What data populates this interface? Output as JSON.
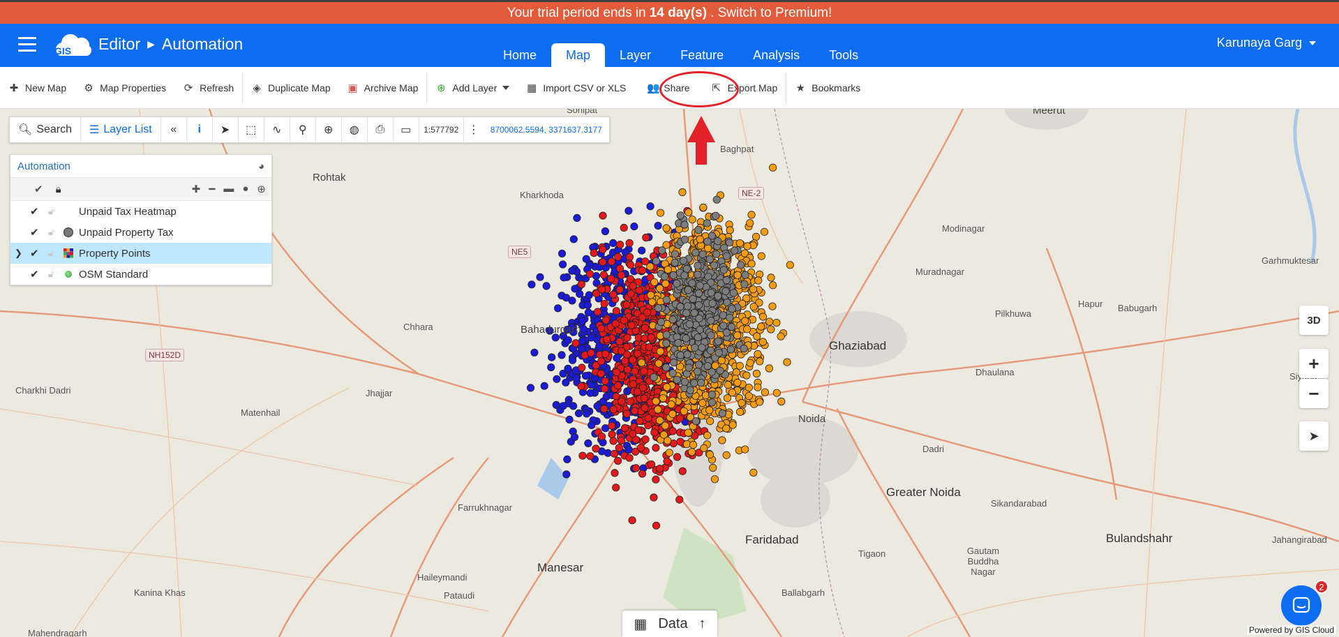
{
  "banner": {
    "prefix": "Your trial period ends in",
    "days": "14 day(s)",
    "suffix": ". Switch to Premium!"
  },
  "header": {
    "logo_text": "GIS",
    "breadcrumb": [
      "Editor",
      "Automation"
    ],
    "tabs": [
      "Home",
      "Map",
      "Layer",
      "Feature",
      "Analysis",
      "Tools"
    ],
    "active_tab": "Map",
    "user": "Karunaya Garg"
  },
  "toolbar": {
    "new_map": "New Map",
    "map_properties": "Map Properties",
    "refresh": "Refresh",
    "duplicate_map": "Duplicate Map",
    "archive_map": "Archive Map",
    "add_layer": "Add Layer",
    "import_csv": "Import CSV or XLS",
    "share": "Share",
    "export_map": "Export Map",
    "bookmarks": "Bookmarks"
  },
  "map_tools": {
    "search": "Search",
    "layer_list": "Layer List",
    "scale": "1:577792",
    "coords": "8700062.5594, 3371637.3177"
  },
  "layer_panel": {
    "map_name": "Automation",
    "layers": [
      {
        "name": "Unpaid Tax Heatmap",
        "symbol": "none"
      },
      {
        "name": "Unpaid Property Tax",
        "symbol": "grey-circle"
      },
      {
        "name": "Property Points",
        "symbol": "grid",
        "selected": true
      },
      {
        "name": "OSM Standard",
        "symbol": "green-dot"
      }
    ]
  },
  "map_labels": {
    "cities_big": [
      "Ghaziabad",
      "Greater Noida",
      "Faridabad",
      "Manesar",
      "Bulandshahr"
    ],
    "towns": [
      "Sonipat",
      "Meerut",
      "Rohtak",
      "Baghpat",
      "Kharkhoda",
      "Modinagar",
      "Muradnagar",
      "Hapur",
      "Babugarh",
      "Garhmuktesar",
      "Pilkhuwa",
      "Chhara",
      "Bahadurgarh",
      "Charkhi Dadri",
      "Jhajjar",
      "Matenhail",
      "Dhaulana",
      "Siyana",
      "Dadri",
      "Sikandarabad",
      "Farrukhnagar",
      "Haileymandi",
      "Pataudi",
      "Kanina Khas",
      "Ballabgarh",
      "Tigaon",
      "Jahangirabad",
      "Gautam Buddha Nagar",
      "Noida",
      "Mahendragarh"
    ],
    "roads": [
      "NE-2",
      "NE5",
      "NH152D"
    ]
  },
  "controls": {
    "three_d": "3D",
    "zoom_in": "+",
    "zoom_out": "−"
  },
  "data_bar": {
    "label": "Data"
  },
  "chat_badge": "2",
  "attribution": "Powered by GIS Cloud",
  "colors": {
    "accent": "#0c6cf2",
    "banner": "#e25c3b",
    "points_blue": "#1b1bd6",
    "points_red": "#e3191c",
    "points_orange": "#f39c12",
    "points_grey": "#7d7d7d"
  }
}
